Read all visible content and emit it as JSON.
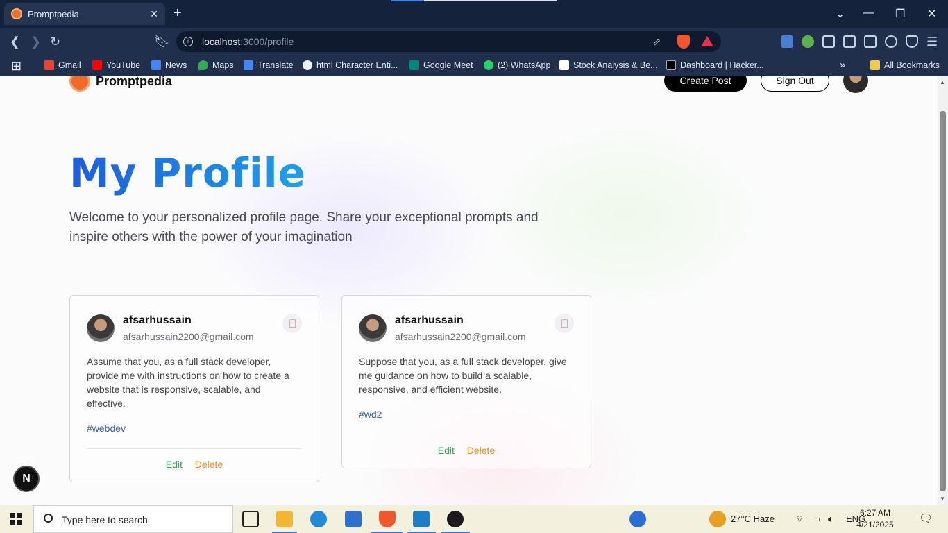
{
  "browser": {
    "tab_title": "Promptpedia",
    "url_host": "localhost",
    "url_path": ":3000/profile",
    "bookmarks": [
      {
        "label": "Gmail",
        "color": "#ea4335"
      },
      {
        "label": "YouTube",
        "color": "#ff0000"
      },
      {
        "label": "News",
        "color": "#4285f4"
      },
      {
        "label": "Maps",
        "color": "#34a853"
      },
      {
        "label": "Translate",
        "color": "#4285f4"
      },
      {
        "label": "html Character Enti...",
        "color": "#f1f1f1"
      },
      {
        "label": "Google Meet",
        "color": "#00897b"
      },
      {
        "label": "(2) WhatsApp",
        "color": "#25d366"
      },
      {
        "label": "Stock Analysis & Be...",
        "color": "#ffffff"
      },
      {
        "label": "Dashboard | Hacker...",
        "color": "#000000"
      }
    ],
    "all_bookmarks": "All Bookmarks",
    "more_chevron": "»"
  },
  "nav": {
    "brand": "Promptpedia",
    "create_post": "Create Post",
    "sign_out": "Sign Out"
  },
  "profile": {
    "title": "My Profile",
    "description": "Welcome to your personalized profile page. Share your exceptional prompts and inspire others with the power of your imagination"
  },
  "cards": [
    {
      "username": "afsarhussain",
      "email": "afsarhussain2200@gmail.com",
      "prompt": "Assume that you, as a full stack developer, provide me with instructions on how to create a website that is responsive, scalable, and effective.",
      "tag": "#webdev",
      "edit": "Edit",
      "delete": "Delete"
    },
    {
      "username": "afsarhussain",
      "email": "afsarhussain2200@gmail.com",
      "prompt": "Suppose that you, as a full stack developer, give me guidance on how to build a scalable, responsive, and efficient website.",
      "tag": "#wd2",
      "edit": "Edit",
      "delete": "Delete"
    }
  ],
  "next_badge": "N",
  "taskbar": {
    "search_placeholder": "Type here to search",
    "weather": "27°C  Haze",
    "language": "ENG",
    "time": "6:27 AM",
    "date": "4/21/2025"
  },
  "colors": {
    "title_gradient_start": "#1e5dd9",
    "title_gradient_end": "#1fa0e8",
    "edit": "#31a95c",
    "delete": "#f08a1f",
    "tag": "#2f5fa8"
  }
}
